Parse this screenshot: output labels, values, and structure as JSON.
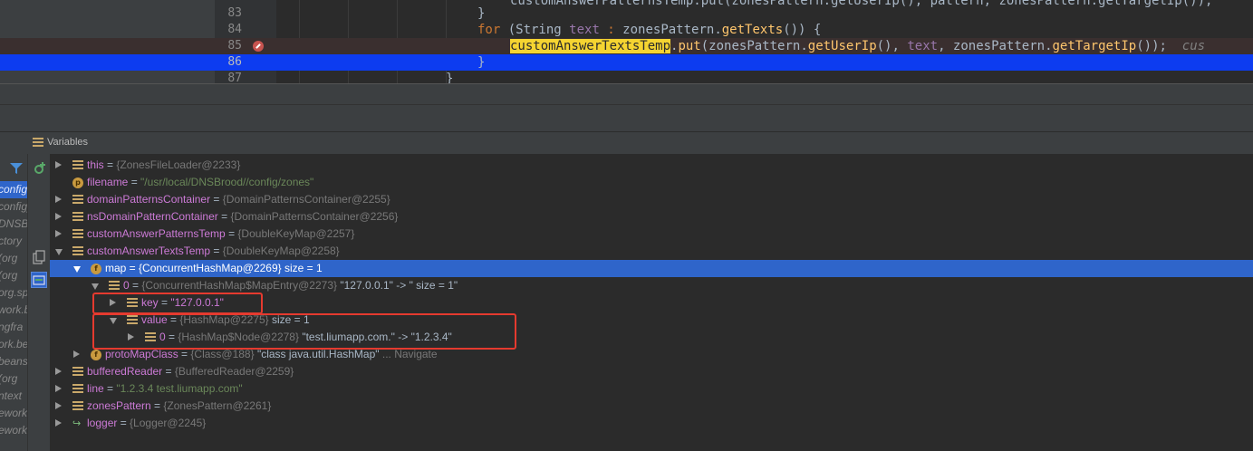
{
  "editor": {
    "lines": [
      {
        "num": "83",
        "html_parts": [
          [
            "",
            "}"
          ]
        ]
      },
      {
        "num": "84",
        "html_parts": [
          [
            "kw",
            "for "
          ],
          [
            "",
            "(String "
          ],
          [
            "fld",
            "text"
          ],
          [
            "kw",
            " : "
          ],
          [
            "",
            "zonesPattern."
          ],
          [
            "fn",
            "getTexts"
          ],
          [
            "",
            "()) {"
          ]
        ]
      },
      {
        "num": "85",
        "html_parts": [
          [
            "hl-word",
            "customAnswerTextsTemp"
          ],
          [
            "",
            "."
          ],
          [
            "fn",
            "put"
          ],
          [
            "",
            "(zonesPattern."
          ],
          [
            "fn",
            "getUserIp"
          ],
          [
            "",
            "(), "
          ],
          [
            "fld",
            "text"
          ],
          [
            "",
            ", zonesPattern."
          ],
          [
            "fn",
            "getTargetIp"
          ],
          [
            "",
            "());  "
          ],
          [
            "dim",
            "cus"
          ]
        ]
      },
      {
        "num": "86",
        "html_parts": [
          [
            "",
            "}"
          ]
        ]
      },
      {
        "num": "87",
        "html_parts": [
          [
            "",
            "}"
          ]
        ]
      }
    ],
    "top_partial": "customAnswerPatternsTemp.put(zonesPattern.getUserIp(), pattern, zonesPattern.getTargetIp());"
  },
  "panel": {
    "title": "Variables"
  },
  "frames": [
    {
      "label": "config",
      "selected": true
    },
    {
      "label": "config)"
    },
    {
      "label": "DNSBroo"
    },
    {
      "label": "ctory"
    },
    {
      "label": "(org"
    },
    {
      "label": "(org"
    },
    {
      "label": "org.sp"
    },
    {
      "label": "work.b"
    },
    {
      "label": "ngfra"
    },
    {
      "label": "ork.be"
    },
    {
      "label": "beans"
    },
    {
      "label": "(org"
    },
    {
      "label": "ntext"
    },
    {
      "label": "ework"
    },
    {
      "label": "ework"
    }
  ],
  "variables": [
    {
      "indent": 0,
      "arrow": "right",
      "icon": "stack",
      "name": "this",
      "type": "{ZonesFileLoader@2233}"
    },
    {
      "indent": 0,
      "arrow": "none",
      "icon": "p",
      "name": "filename",
      "str": "\"/usr/local/DNSBrood//config/zones\""
    },
    {
      "indent": 0,
      "arrow": "right",
      "icon": "stack",
      "name": "domainPatternsContainer",
      "type": "{DomainPatternsContainer@2255}"
    },
    {
      "indent": 0,
      "arrow": "right",
      "icon": "stack",
      "name": "nsDomainPatternContainer",
      "type": "{DomainPatternsContainer@2256}"
    },
    {
      "indent": 0,
      "arrow": "right",
      "icon": "stack",
      "name": "customAnswerPatternsTemp",
      "type": "{DoubleKeyMap@2257}"
    },
    {
      "indent": 0,
      "arrow": "down",
      "icon": "stack",
      "name": "customAnswerTextsTemp",
      "type": "{DoubleKeyMap@2258}"
    },
    {
      "indent": 1,
      "arrow": "down",
      "icon": "f",
      "name": "map",
      "type": "{ConcurrentHashMap@2269}",
      "extra": "  size = 1",
      "selected": true
    },
    {
      "indent": 2,
      "arrow": "down",
      "icon": "stack",
      "name": "0",
      "type": "{ConcurrentHashMap$MapEntry@2273}",
      "extra": " \"127.0.0.1\" -> \" size = 1\""
    },
    {
      "indent": 3,
      "arrow": "right",
      "icon": "stack",
      "name": "key",
      "strv": "\"127.0.0.1\""
    },
    {
      "indent": 3,
      "arrow": "down",
      "icon": "stack",
      "name": "value",
      "type": "{HashMap@2275}",
      "extra": "  size = 1"
    },
    {
      "indent": 4,
      "arrow": "right",
      "icon": "stack",
      "name": "0",
      "type": "{HashMap$Node@2278}",
      "extra": " \"test.liumapp.com.\" -> \"1.2.3.4\""
    },
    {
      "indent": 1,
      "arrow": "right",
      "icon": "f",
      "name": "protoMapClass",
      "type": "{Class@188}",
      "extra": " \"class java.util.HashMap\"",
      "nav": " ... Navigate"
    },
    {
      "indent": 0,
      "arrow": "right",
      "icon": "stack",
      "name": "bufferedReader",
      "type": "{BufferedReader@2259}"
    },
    {
      "indent": 0,
      "arrow": "right",
      "icon": "stack",
      "name": "line",
      "str": "\"1.2.3.4 test.liumapp.com\""
    },
    {
      "indent": 0,
      "arrow": "right",
      "icon": "stack",
      "name": "zonesPattern",
      "type": "{ZonesPattern@2261}"
    },
    {
      "indent": 0,
      "arrow": "right",
      "icon": "logger",
      "name": "logger",
      "type": "{Logger@2245}"
    }
  ],
  "icons": {
    "filter": "filter-icon",
    "add_watch": "add-watch-icon",
    "copy": "copy-icon",
    "restore": "restore-layout-icon"
  },
  "colors": {
    "selection": "#2f65ca",
    "highlight_box": "#e53a2f",
    "current_line": "#0d3cf0"
  }
}
